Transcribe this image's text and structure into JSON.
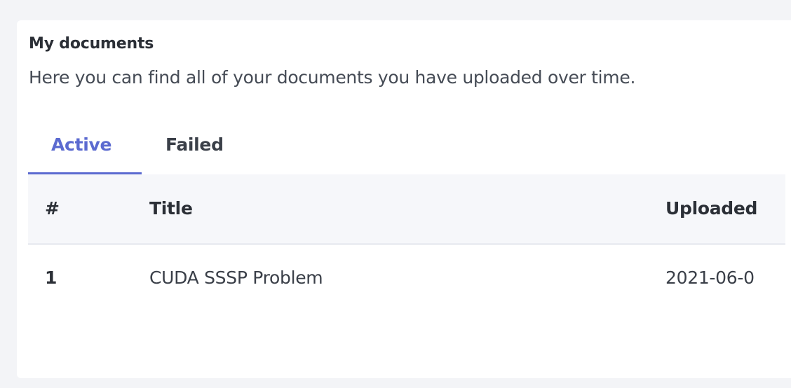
{
  "card": {
    "title": "My documents",
    "subtitle": "Here you can find all of your documents you have uploaded over time."
  },
  "tabs": [
    {
      "label": "Active",
      "active": true
    },
    {
      "label": "Failed",
      "active": false
    }
  ],
  "table": {
    "columns": [
      "#",
      "Title",
      "Uploaded"
    ],
    "rows": [
      {
        "num": "1",
        "title": "CUDA SSSP Problem",
        "uploaded": "2021-06-0"
      }
    ]
  },
  "colors": {
    "accent": "#5b6ad0",
    "background": "#f3f4f7",
    "card": "#ffffff",
    "table_header": "#f6f7fa"
  }
}
